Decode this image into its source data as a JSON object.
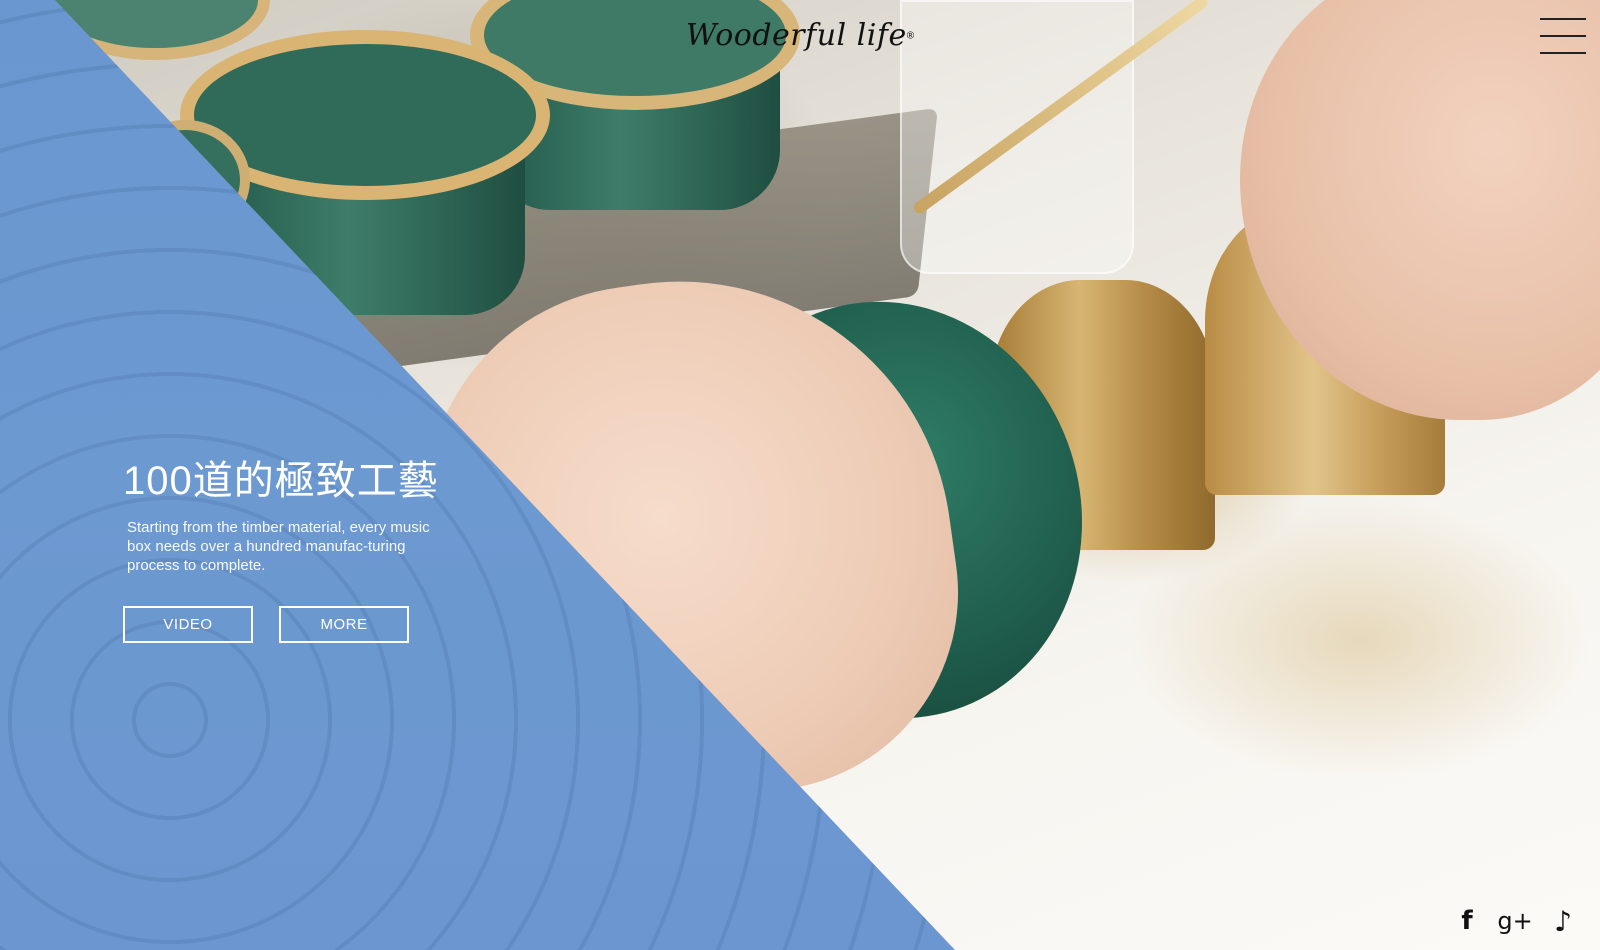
{
  "header": {
    "logo_text": "Wooderful life",
    "logo_mark": "®",
    "menu_icon": "hamburger-menu-icon"
  },
  "hero": {
    "title": "100道的極致工藝",
    "description": "Starting from the timber material, every music box needs over a hundred manufac-turing process to complete.",
    "buttons": [
      {
        "label": "VIDEO"
      },
      {
        "label": "MORE"
      }
    ]
  },
  "social": {
    "facebook": {
      "icon": "facebook-icon",
      "glyph": "f"
    },
    "google_plus": {
      "icon": "google-plus-icon",
      "glyph": "g+"
    },
    "music": {
      "icon": "music-note-icon",
      "glyph": "♪"
    }
  },
  "colors": {
    "panel_blue": "#6b96cf",
    "text_white": "#ffffff",
    "icon_dark": "#111111"
  }
}
